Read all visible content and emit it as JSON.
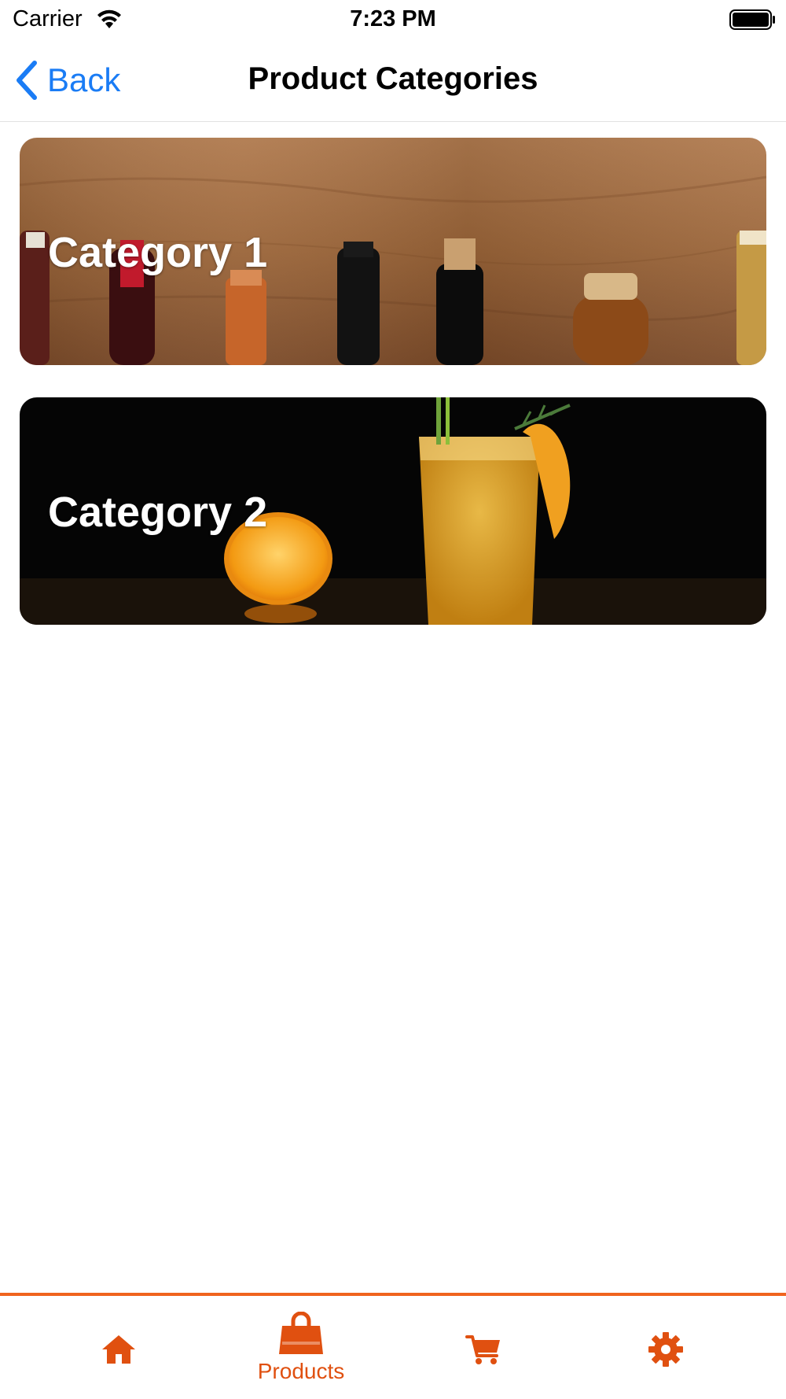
{
  "status_bar": {
    "carrier": "Carrier",
    "time": "7:23 PM"
  },
  "nav": {
    "back_label": "Back",
    "title": "Product Categories"
  },
  "categories": [
    {
      "label": "Category 1",
      "image": "bottles-on-wood-photo"
    },
    {
      "label": "Category 2",
      "image": "orange-cocktail-photo"
    }
  ],
  "tab_bar": {
    "accent_color": "#e05010",
    "tabs": [
      {
        "icon": "home-icon",
        "label": ""
      },
      {
        "icon": "shopping-bag-icon",
        "label": "Products",
        "selected": true
      },
      {
        "icon": "cart-icon",
        "label": ""
      },
      {
        "icon": "gear-icon",
        "label": ""
      }
    ]
  },
  "colors": {
    "link": "#1a7cf5",
    "accent": "#e05010",
    "tab_bar_border": "#f0641e"
  }
}
